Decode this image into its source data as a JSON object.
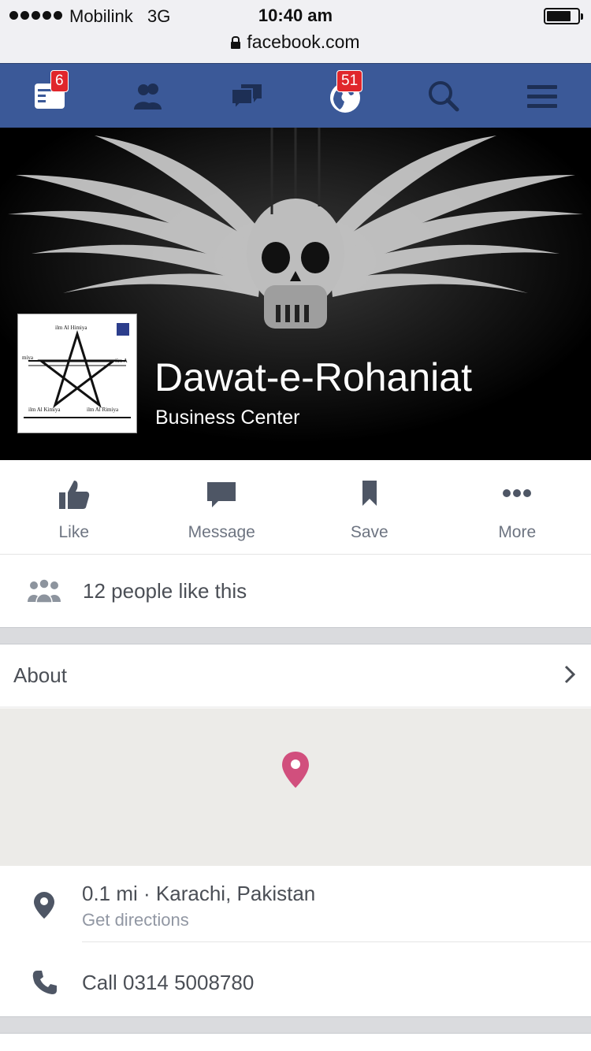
{
  "status_bar": {
    "carrier": "Mobilink",
    "network": "3G",
    "time": "10:40 am",
    "battery_level": 0.8
  },
  "browser": {
    "url": "facebook.com",
    "lock_icon": "lock-icon"
  },
  "nav": {
    "items": [
      {
        "icon": "news-feed-icon",
        "badge": "6"
      },
      {
        "icon": "friend-requests-icon",
        "badge": ""
      },
      {
        "icon": "messages-icon",
        "badge": ""
      },
      {
        "icon": "notifications-globe-icon",
        "badge": "51"
      },
      {
        "icon": "search-icon",
        "badge": ""
      },
      {
        "icon": "menu-icon",
        "badge": ""
      }
    ],
    "bg_color": "#3b5998",
    "badge_color": "#e0262b"
  },
  "page": {
    "name": "Dawat-e-Rohaniat",
    "category": "Business Center",
    "profile_labels": [
      "ilm Al Himiya",
      "ilm Al Kimiya",
      "ilm Al Rimiya",
      "ilm A",
      "miya"
    ]
  },
  "actions": [
    {
      "label": "Like",
      "icon": "like-thumb-icon"
    },
    {
      "label": "Message",
      "icon": "message-bubble-icon"
    },
    {
      "label": "Save",
      "icon": "bookmark-icon"
    },
    {
      "label": "More",
      "icon": "more-dots-icon"
    }
  ],
  "likes": {
    "text": "12 people like this",
    "icon": "people-icon"
  },
  "about": {
    "label": "About",
    "icon": "chevron-right-icon"
  },
  "map": {
    "pin_color": "#d14f7d"
  },
  "location": {
    "distance_place": "0.1 mi · Karachi, Pakistan",
    "directions": "Get directions",
    "icon": "location-pin-icon"
  },
  "call": {
    "text": "Call 0314 5008780",
    "icon": "phone-icon"
  }
}
